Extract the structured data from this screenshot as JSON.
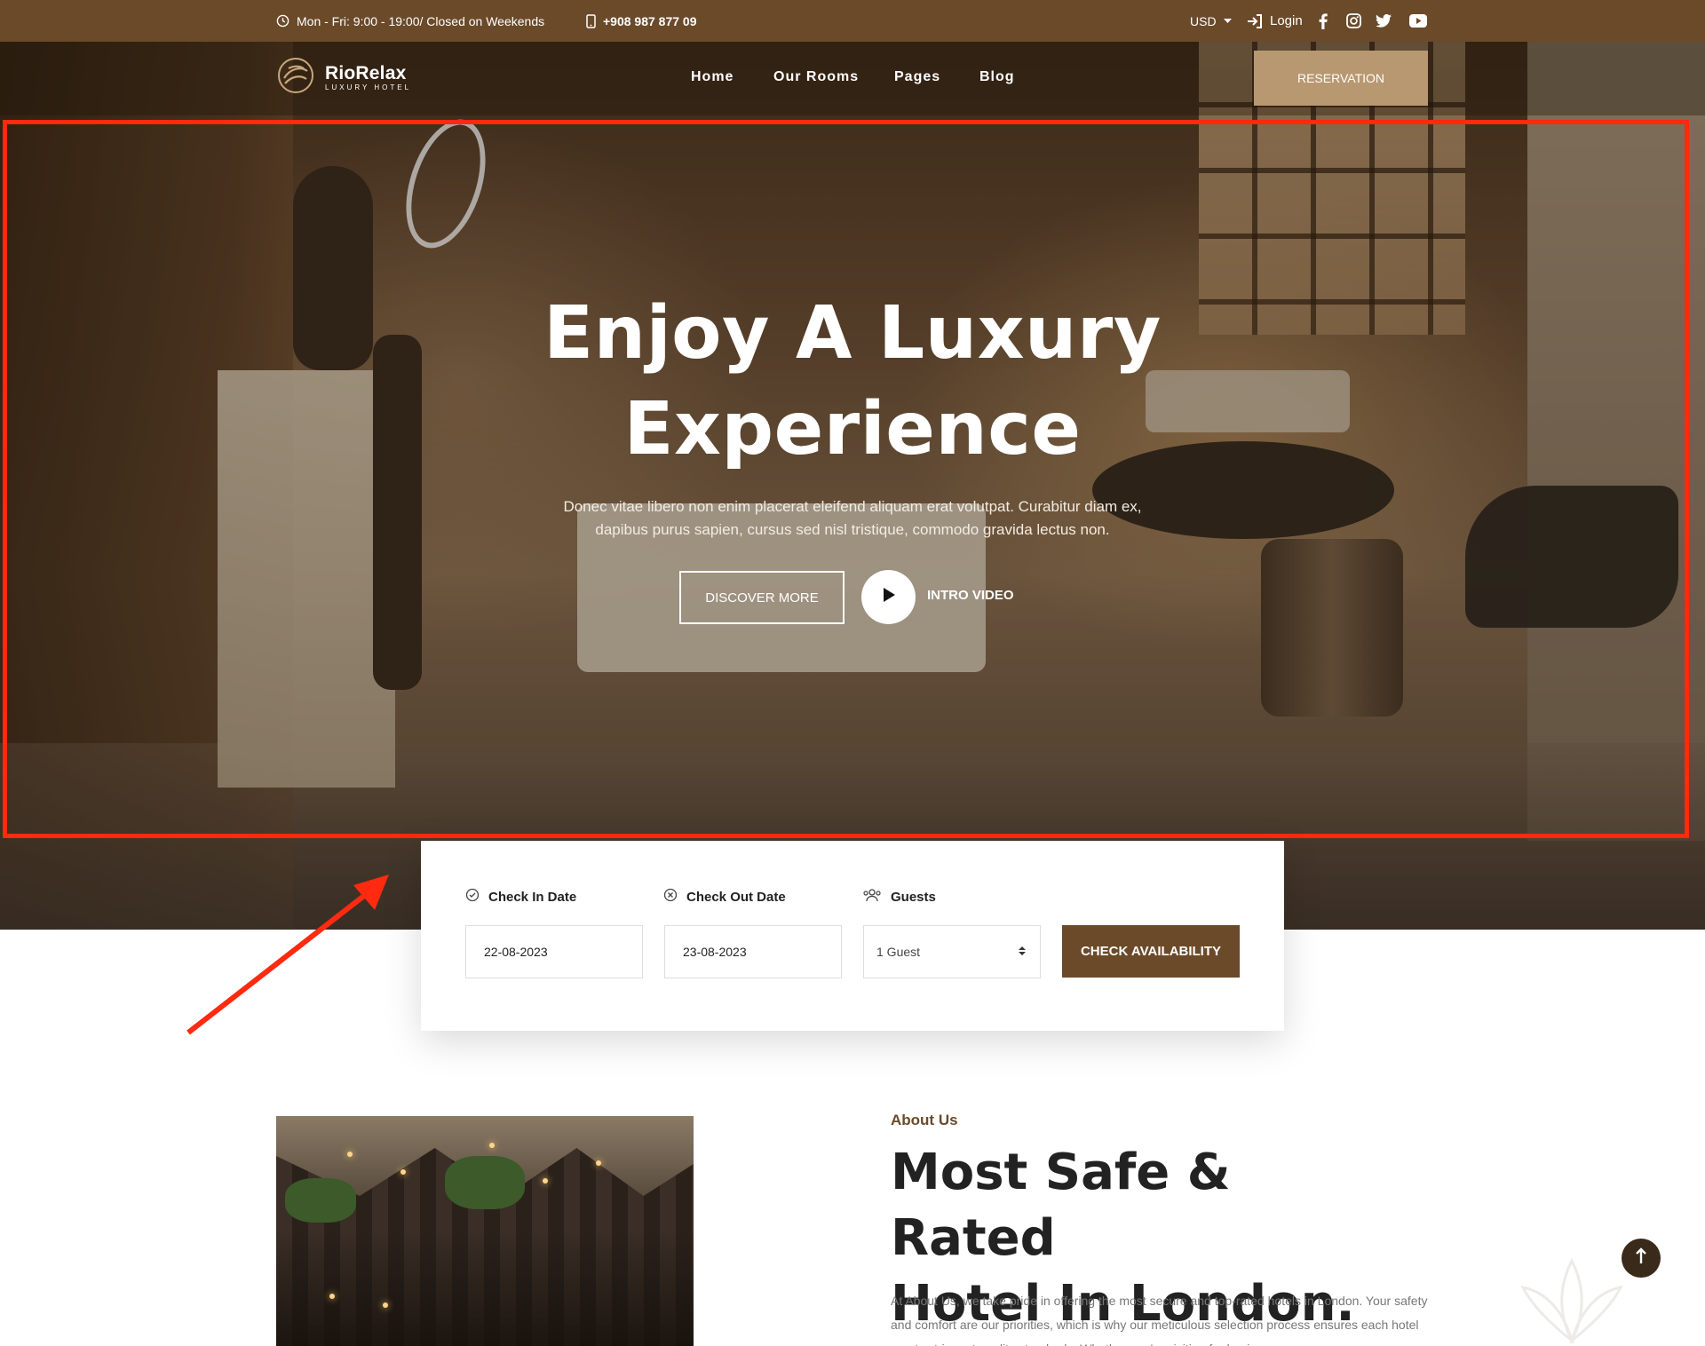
{
  "topbar": {
    "hours": "Mon - Fri: 9:00 - 19:00/ Closed on Weekends",
    "phone": "+908 987 877 09",
    "currency": "USD",
    "login": "Login"
  },
  "nav": {
    "brand": "RioRelax",
    "brand_sub": "LUXURY HOTEL",
    "links": [
      "Home",
      "Our Rooms",
      "Pages",
      "Blog"
    ],
    "reservation": "RESERVATION"
  },
  "hero": {
    "title_line1": "Enjoy A Luxury",
    "title_line2": "Experience",
    "desc_line1": "Donec vitae libero non enim placerat eleifend aliquam erat volutpat. Curabitur diam ex,",
    "desc_line2": "dapibus purus sapien, cursus sed nisl tristique, commodo gravida lectus non.",
    "discover": "DISCOVER MORE",
    "video": "INTRO VIDEO"
  },
  "booking": {
    "checkin_label": "Check In Date",
    "checkout_label": "Check Out Date",
    "guests_label": "Guests",
    "checkin_value": "22-08-2023",
    "checkout_value": "23-08-2023",
    "guests_value": "1 Guest",
    "button": "CHECK AVAILABILITY"
  },
  "about": {
    "kicker": "About Us",
    "title_line1": "Most Safe & Rated",
    "title_line2": "Hotel In London.",
    "text": "At About Us, we take pride in offering the most secure and top-rated hotels in London. Your safety and comfort are our priorities, which is why our meticulous selection process ensures each hotel meets stringent quality standards. Whether you're visiting for business"
  },
  "colors": {
    "brand_brown": "#6b4a2a",
    "accent_tan": "#b89870",
    "annotation_red": "#ff2a10"
  },
  "icons": [
    "clock-icon",
    "phone-icon",
    "caret-down-icon",
    "login-icon",
    "facebook-icon",
    "instagram-icon",
    "twitter-icon",
    "youtube-icon",
    "play-icon",
    "check-circle-icon",
    "x-circle-icon",
    "users-icon",
    "sort-icon",
    "arrow-up-icon"
  ]
}
